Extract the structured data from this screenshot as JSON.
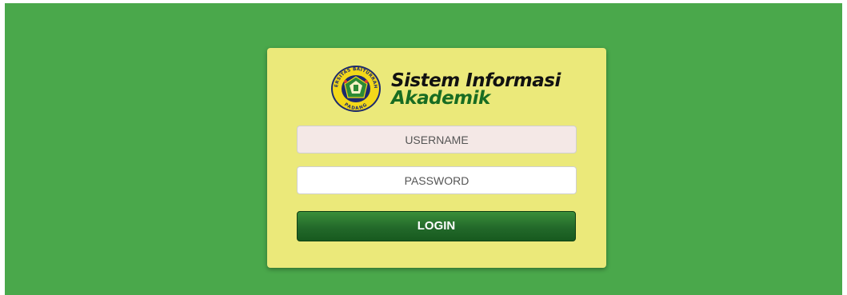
{
  "brand": {
    "title_line1": "Sistem Informasi",
    "title_line2": "Akademik",
    "logo_text_top": "UNIVERSITAS BAITURRAHMAH",
    "logo_text_bottom": "PADANG"
  },
  "form": {
    "username": {
      "value": "",
      "placeholder": "USERNAME"
    },
    "password": {
      "value": "",
      "placeholder": "PASSWORD"
    },
    "login_label": "LOGIN"
  },
  "colors": {
    "background": "#4aa84b",
    "card": "#ebe97a",
    "title_dark": "#111111",
    "title_green": "#186c22",
    "button": "#23692a",
    "username_field": "#f4e8e6"
  },
  "icons": {
    "logo": "university-seal-icon"
  }
}
